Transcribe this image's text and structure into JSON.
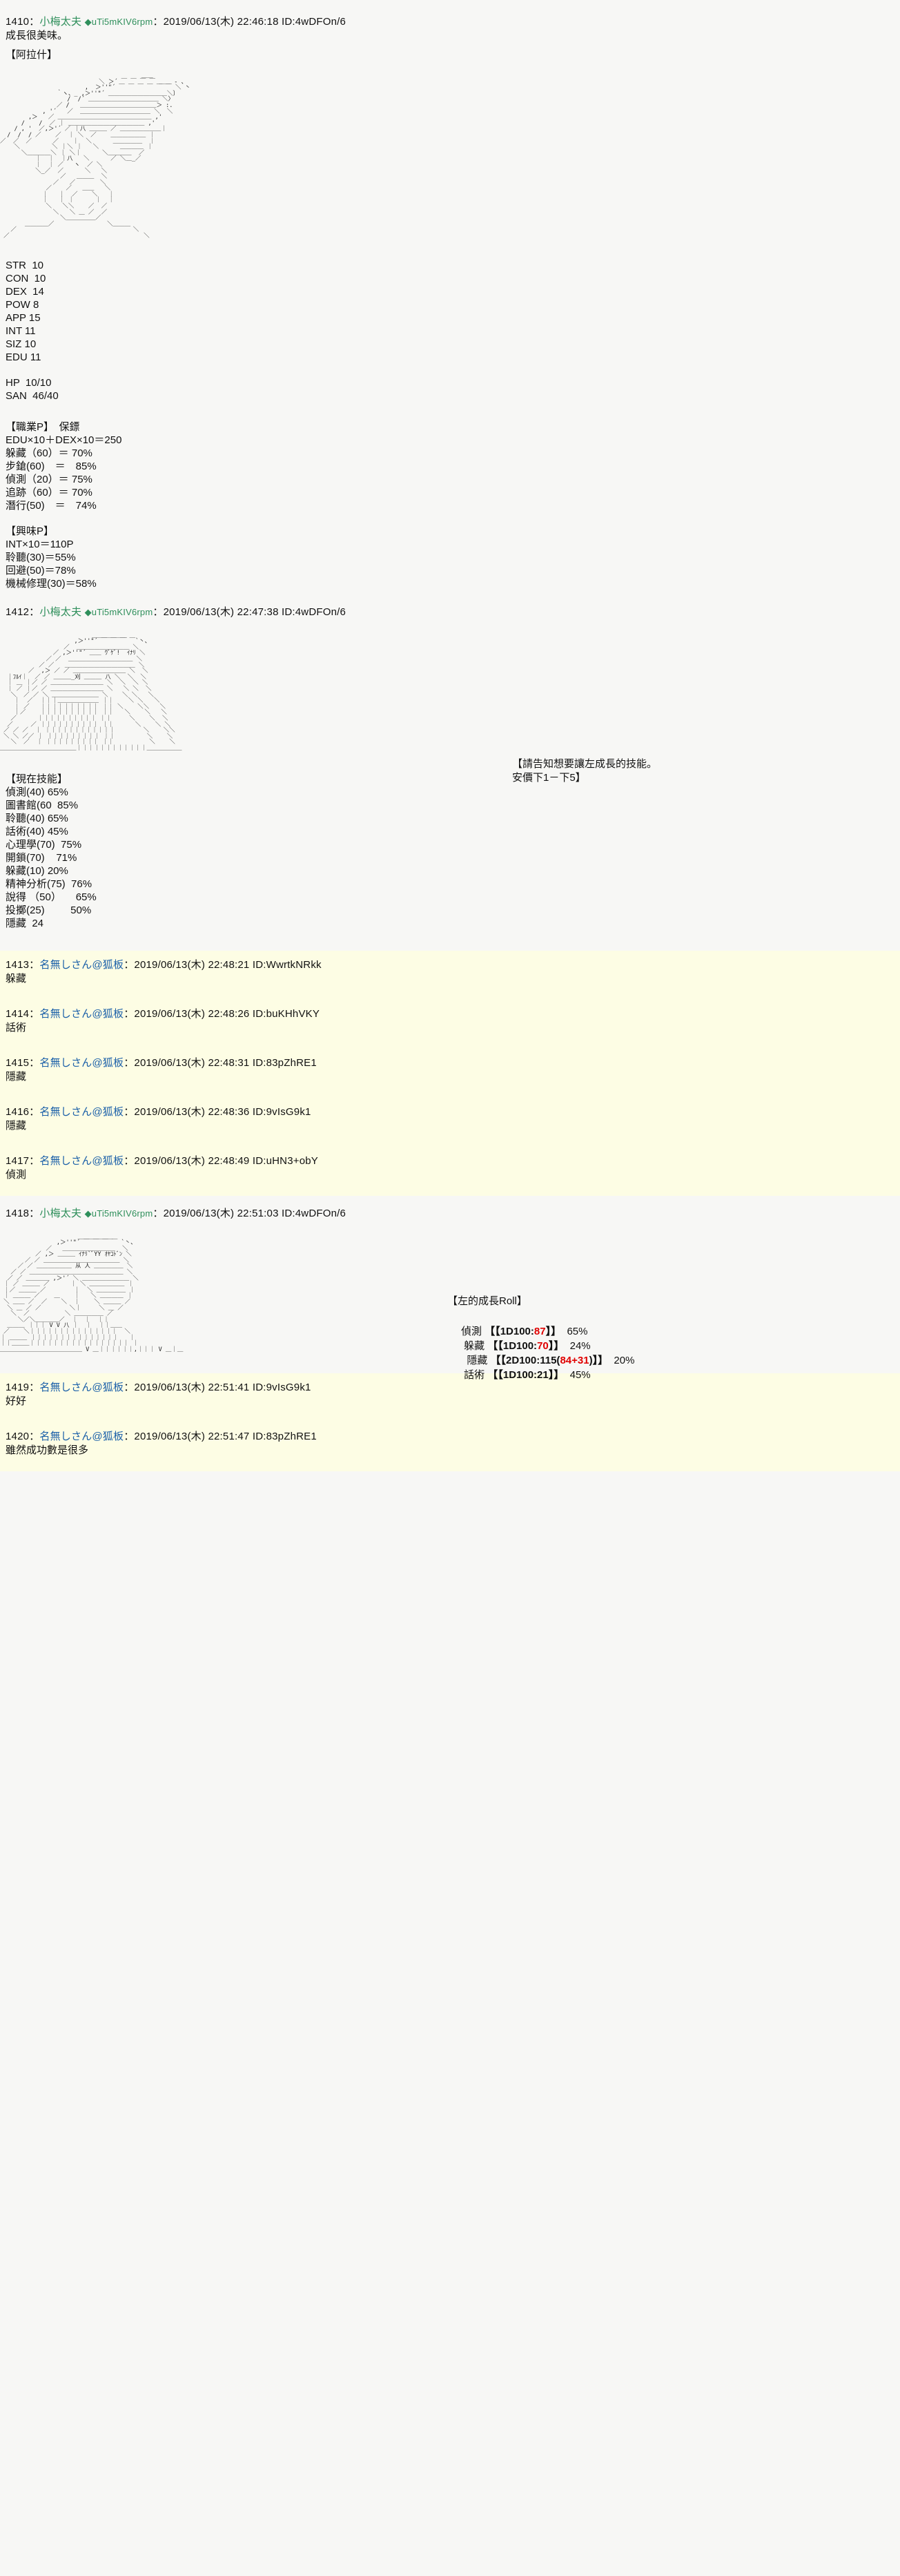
{
  "board": {
    "op_name": "小梅太夫",
    "op_trip": "◆uTi5mKIV6rpm",
    "anon_name": "名無しさん@狐板",
    "date_prefix": "2019/06/13(木)",
    "colon": "：",
    "colors": {
      "op_name": "#2f8f5b",
      "anon_name": "#1a5fa8",
      "reply_bg": "#fdfde4",
      "page_bg": "#f7f7f5",
      "crit_red": "#e00000"
    }
  },
  "posts": [
    {
      "num": "1410",
      "name": "小梅太夫",
      "trip": "◆uTi5mKIV6rpm",
      "time": "22:46:18",
      "id": "ID:4wDFOn/6",
      "body_line1": "成長很美味。",
      "body_line2": "【阿拉什】"
    },
    {
      "num": "1412",
      "name": "小梅太夫",
      "trip": "◆uTi5mKIV6rpm",
      "time": "22:47:38",
      "id": "ID:4wDFOn/6"
    },
    {
      "num": "1413",
      "name": "名無しさん@狐板",
      "time": "22:48:21",
      "id": "ID:WwrtkNRkk",
      "body": "躲藏"
    },
    {
      "num": "1414",
      "name": "名無しさん@狐板",
      "time": "22:48:26",
      "id": "ID:buKHhVKY",
      "body": "話術"
    },
    {
      "num": "1415",
      "name": "名無しさん@狐板",
      "time": "22:48:31",
      "id": "ID:83pZhRE1",
      "body": "隱藏"
    },
    {
      "num": "1416",
      "name": "名無しさん@狐板",
      "time": "22:48:36",
      "id": "ID:9vIsG9k1",
      "body": "隱藏"
    },
    {
      "num": "1417",
      "name": "名無しさん@狐板",
      "time": "22:48:49",
      "id": "ID:uHN3+obY",
      "body": "偵測"
    },
    {
      "num": "1418",
      "name": "小梅太夫",
      "trip": "◆uTi5mKIV6rpm",
      "time": "22:51:03",
      "id": "ID:4wDFOn/6"
    },
    {
      "num": "1419",
      "name": "名無しさん@狐板",
      "time": "22:51:41",
      "id": "ID:9vIsG9k1",
      "body": "好好"
    },
    {
      "num": "1420",
      "name": "名無しさん@狐板",
      "time": "22:51:47",
      "id": "ID:83pZhRE1",
      "body": "雖然成功數是很多"
    }
  ],
  "character_sheet": {
    "attributes": [
      "STR  10",
      "CON  10",
      "DEX  14",
      "POW 8",
      "APP 15",
      "INT 11",
      "SIZ 10",
      "EDU 11"
    ],
    "derived": [
      "HP  10/10",
      "SAN  46/40"
    ],
    "occupation": {
      "title": "【職業P】　保鏢",
      "formula": "EDU×10＋DEX×10＝250",
      "skills": [
        "躲藏（60）＝ 70%",
        "步鎗(60)　＝　85%",
        "偵測（20）＝ 75%",
        "追跡（60）＝ 70%",
        "潛行(50)　＝　74%"
      ]
    },
    "hobby": {
      "title": "【興味P】",
      "formula": "INT×10＝110P",
      "skills": [
        "聆聽(30)＝55%",
        "回避(50)＝78%",
        "機械修理(30)＝58%"
      ]
    }
  },
  "current_skills": {
    "title": "【現在技能】",
    "group1": [
      "偵測(40) 65%",
      "圖書館(60  85%",
      "聆聽(40) 65%",
      "話術(40) 45%",
      "心理學(70)  75%",
      "開鎖(70)    71%"
    ],
    "group2": [
      "躲藏(10) 20%",
      "精神分析(75)  76%",
      "說得 （50）     65%",
      "投擲(25)         50%",
      "隱藏  24"
    ]
  },
  "balloon": {
    "line1": "【請告知想要讓左成長的技能。",
    "line2": "安價下1－下5】"
  },
  "roll_result": {
    "title": "【左的成長Roll】",
    "rows": [
      {
        "skill": "偵測",
        "pre": "【【1D100:",
        "roll": "87",
        "post": "】】",
        "value": "65%"
      },
      {
        "skill": "躲藏",
        "pre": "【【1D100:",
        "roll": "70",
        "post": "】】",
        "value": "24%"
      },
      {
        "skill": "隱藏",
        "pre": "【【2D100:115(",
        "roll": "84+31",
        "post": ")】】",
        "value": "20%"
      },
      {
        "skill": "話術",
        "pre": "【【1D100:21",
        "roll": "",
        "post": "】】",
        "value": "45%"
      }
    ]
  },
  "aa": {
    "art1": "                                        ＿＿\n                            ＼ ＞´ ￣ ￣ ￣ ￣ ＿＿ ‐ 、\n                        ,  ＞''\"´ ￣ ￣ ￣ ￣ ￣ ￣ ＼ 丶\n                ｀ヽ、_ ,＞''\"´ ＿＿＿＿＿＿＿＿＿＿＼〕\n                   /  /´ ＿＿＿＿＿＿＿＿＿＿＿＿ ＼〉\n                ／ /   ＿＿＿＿＿＿＿＿＿＿＿＿＿＞ :.\n            , '´   ／  ＿＿＿＿＿＿＿＿＿＿＿＿ ＼  ＼\n        ,＞   ／ ＿＿＿＿＿＿＿＿＿＿＿＿＿＿＿＿ ,'\n      /    /  ／ ｜ ＿＿＿＿＿＿＿＿＿＿＿＿＿ ,'\n    / , '  ／,＞'´ ／ ｜八 ＿＿＿ ／ ＿＿＿＿＿＿＿｜\n  /  /  / ／    ／  ｜ ＼  ／    ＿＿＿＿＿＿ ｜\n／  ／  ／      ／    ｜  ＼      ＿＿＿＿＿  ｜\n    ＼         ＼ ｜＼ ｜   ＼      ＿＿＿＿ ｜\n      ＼＿＿＿＿＼ ｜ ＼｜      ＼＿＿＿＿  ／\n          ｜  ｜  ｜八   ＼      ／ ＼＿_／\n          ｜  ｜ ／   ヽ  ／ ＼\n          ＼_／  ／      ＼   ＼\n                 ／   ＿＿＿  ＼\n               ／   ／       ＼\n             ／    ／   ＿＿   ＼\n            ｜   ｜  ／    ＼   ｜\n            ｜   ｜ ｜      ｜  ｜\n             ＼   ＼＼    ／  ／\n               ＼   ＼ ＿ ／  ／\n                 ＼＿＿＿＿＿／\n       ＿＿＿＿／               ＼＿＿＿\n   ／                                 ＼\n ／                                      ＼",
    "art2": "                          ＿＿＿＿＿＿\n                     ,＞''\"´ ￣ ￣ ￣ ￣`丶、\n                  ／  ＿＿＿＿＿＿＿＿＿ ＼\n               ／ ,＞''\"´ ＿＿ ｳﾞｹﾞ!  ｲﾅﾘ ＼\n             ／ ／  ＿＿＿＿＿＿＿＿＿＿＿ ＼\n           ／ ／   ＿＿＿＿＿＿＿＿＿＿＿＿ ＼\n        ／  ,＞ ／ ／ ＿＿＿＿＿＿＿＿＿ ＼  ＼\n  ｜ﾌﾙｲ｜  ／ ／ ＿＿＿_刈 ＿＿＿ 八 ＼  ＼  ＼\n  ｜ ＿ ｜／ ／ ＿＿＿＿＿＿＿＿＿ ＼  ＼  ＼ ＼\n  ｜ ／ ｜／ ／ ＿＿＿＿＿＿＿＿＿ ＼   ＼ ＼  ＼\n   ＼  ／ ／ ＼ ＿＿＿＿＿＿＿＿ ＼    ＼ ＼   ＼\n    ｜  ／  ｜｜｜＿＿＿＿＿＿＿ ｜｜    ＼ ＼   ＼\n    ｜ ／   ｜｜｜｜｜｜｜｜｜｜ ｜｜ ＼    ＼＼   ＼\n    ｜／    ｜｜｜｜｜｜｜｜｜｜ ｜｜   ＼    ＼   ＼\n   ／      ｜｜｜｜｜｜｜｜｜｜ ｜｜     ＼    ＼  ＼\n  ／     ／ ｜｜｜｜｜｜｜｜｜｜ ｜｜      ＼    ＼ ＼\n ／ ／ ／  ｜ ｜｜｜｜｜｜｜｜｜｜｜｜        ＼    ＼＼\n ＼ ＼ ／／ ｜ ｜｜｜｜｜｜｜｜｜ ｜｜         ＼    ＼\n   ＼  ／  ｜ ｜｜｜｜｜｜｜｜｜ ｜｜          ＼    ＼\n＿＿＿＿＿＿＿＿＿＿＿＿＿｜｜｜｜｜｜｜｜｜｜｜｜＿＿＿＿＿＿",
    "art3": "                      ＿＿＿＿＿＿\n                ,＞''\"´ ￣ ￣ ￣ ￣ `丶、\n             ／   ＿＿＿＿＿＿＿＿＿  ＼\n          ／ ,＞ ＿＿＿ ｲﾅﾘ`ﾞYY ｵﾔｺﾄﾞﾝ ＼\n       ／ ／ ＿＿＿＿＿＿＿＿＿＿＿＿＿ ＼\n     ／ ／ ＿＿＿＿＿＿ 从 人 ＿＿＿＿＿ ＼\n   ／ ／ ＿＿＿＿＿＿＿＿＿＿＿＿＿＿＿＿ ＼\n  ／ ／ ＿＿＿＿ ,＞'´ ＼ ＿＿＿＿＿＿＿＿ ＼\n ｜ ／ ＿＿＿ ／      ｜ ＼ ＿＿＿＿＿＿ ｜\n ｜／ ＿＿＿ ／        ｜  ＼ ＿＿＿＿＿ ｜\n ｜ ＿＿＿ ／    ＿    ｜   ＼ ＿＿＿＿ ｜\n ＼ ＿＿ ／  ／    ＼  ｜    ＼ ＿＿＿ ／\n  ＼ ＿ ／ ／        ＼｜     ＼ ＿ ／\n   ＼  ／          ＼ ＿＿＿＿＿ ／\n     ＼／＼＿＿＿＿／  ｜  ｜  ｜｜\n  ＿＿＿ ｜｜｜ V V 八 ｜  ｜  ｜｜＿＿\n ／    ＼｜｜｜｜｜｜｜｜｜｜｜｜｜｜｜  ＼\n｜ ＿＿＿ ｜｜｜｜｜｜｜｜｜｜｜｜｜｜｜   ｜\n｜｜＿＿＿｜｜｜｜｜｜｜｜｜｜｜｜｜｜｜｜｜ ｜\n＿＿＿＿＿＿＿＿＿＿＿＿＿＿ V ＿｜｜｜｜｜｜,｜｜｜ V ＿｜＿"
  }
}
